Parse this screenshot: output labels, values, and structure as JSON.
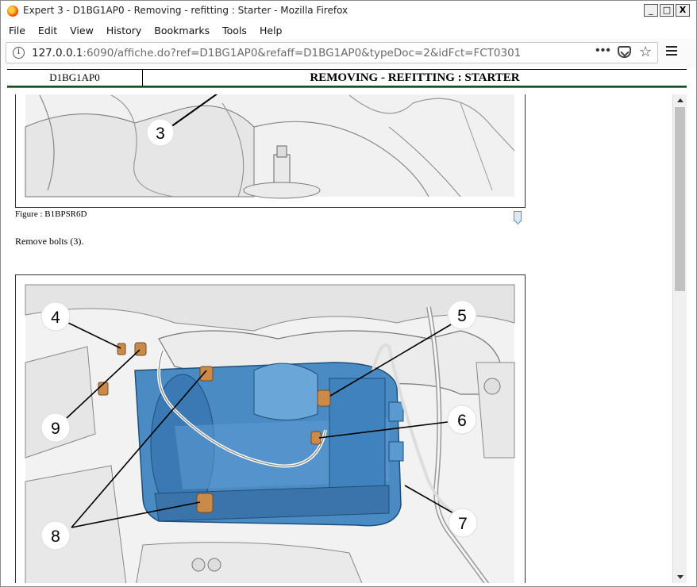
{
  "window": {
    "title": "Expert 3 - D1BG1AP0 - Removing - refitting : Starter - Mozilla Firefox",
    "buttons": {
      "minimize": "_",
      "maximize": "□",
      "close": "X"
    }
  },
  "menu": [
    {
      "label": "File"
    },
    {
      "label": "Edit"
    },
    {
      "label": "View"
    },
    {
      "label": "History"
    },
    {
      "label": "Bookmarks"
    },
    {
      "label": "Tools"
    },
    {
      "label": "Help"
    }
  ],
  "address": {
    "host": "127.0.0.1",
    "path": ":6090/affiche.do?ref=D1BG1AP0&refaff=D1BG1AP0&typeDoc=2&idFct=FCT0301",
    "more": "•••",
    "star": "☆"
  },
  "doc": {
    "code": "D1BG1AP0",
    "heading": "REMOVING - REFITTING : STARTER"
  },
  "figure1": {
    "caption": "Figure : B1BPSR6D",
    "callouts": [
      "3"
    ]
  },
  "instruction": "Remove bolts (3).",
  "figure2": {
    "callouts": [
      "4",
      "5",
      "6",
      "7",
      "8",
      "9"
    ]
  },
  "icons": {
    "browser": "firefox-icon",
    "info": "info-icon",
    "pocket": "pocket-icon",
    "bookmark": "bookmark-star-icon",
    "menu": "hamburger-menu-icon",
    "figure_link": "bookmark-icon"
  }
}
